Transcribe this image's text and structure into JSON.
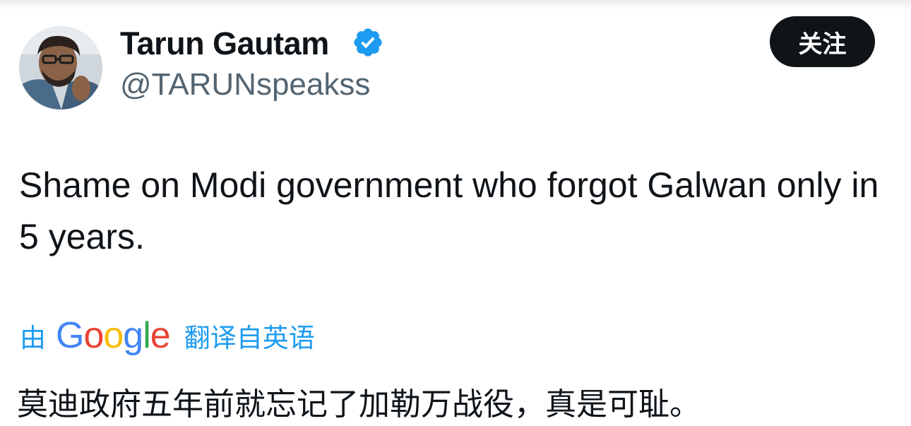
{
  "author": {
    "display_name": "Tarun Gautam",
    "handle": "@TARUNspeakss",
    "verified_icon": "verified-badge-icon",
    "avatar_alt": "profile photo"
  },
  "follow_button": {
    "label": "关注"
  },
  "tweet": {
    "text": "Shame on Modi government who forgot Galwan only in 5 years."
  },
  "translation": {
    "prefix": "由",
    "provider_letters": [
      "G",
      "o",
      "o",
      "g",
      "l",
      "e"
    ],
    "suffix": "翻译自英语",
    "translated_text": "莫迪政府五年前就忘记了加勒万战役，真是可耻。"
  },
  "colors": {
    "accent": "#1d9bf0",
    "text_primary": "#0f1419",
    "text_secondary": "#536471",
    "button_bg": "#0f1419",
    "google_blue": "#4285f4",
    "google_red": "#ea4335",
    "google_yellow": "#fbbc05",
    "google_green": "#34a853"
  }
}
